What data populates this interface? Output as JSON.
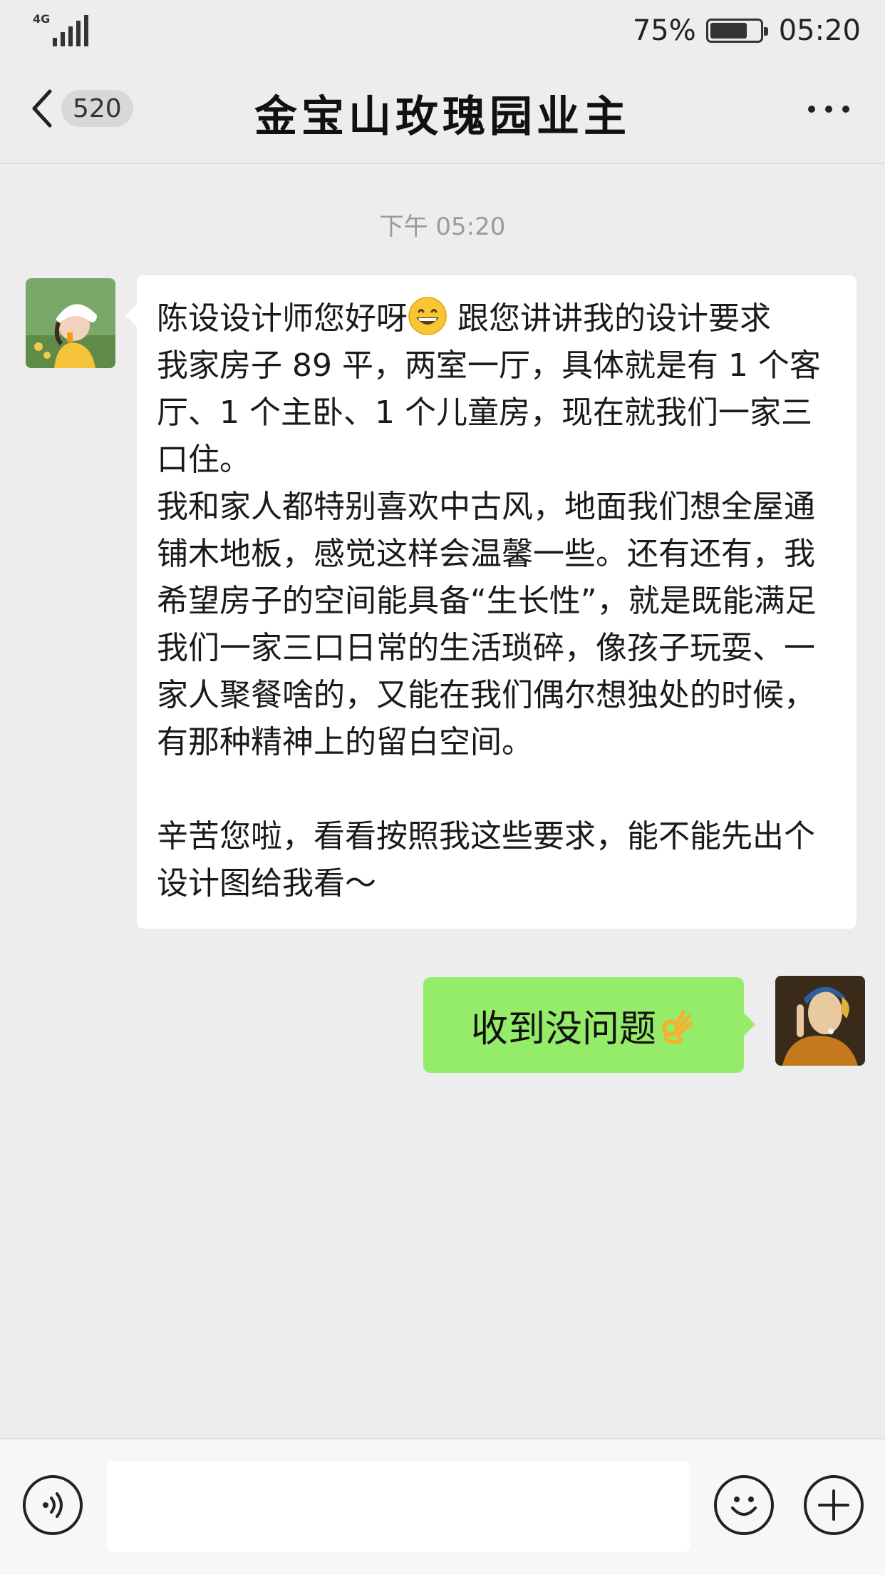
{
  "status_bar": {
    "network": "4G",
    "battery_percent": "75%",
    "battery_level": 0.75,
    "time": "05:20"
  },
  "nav": {
    "unread_badge": "520",
    "title": "金宝山玫瑰园业主"
  },
  "chat": {
    "timestamp": "下午 05:20",
    "incoming": {
      "line_1_before_emoji": "陈设设计师您好呀",
      "line_1_after_emoji": " 跟您讲讲我的设计要求",
      "paragraph_1": "我家房子 89 平，两室一厅，具体就是有 1 个客厅、1 个主卧、1 个儿童房，现在就我们一家三口住。",
      "paragraph_2": "我和家人都特别喜欢中古风，地面我们想全屋通铺木地板，感觉这样会温馨一些。还有还有，我希望房子的空间能具备“生长性”，就是既能满足我们一家三口日常的生活琐碎，像孩子玩耍、一家人聚餐啥的，又能在我们偶尔想独处的时候，有那种精神上的留白空间。",
      "paragraph_3": "辛苦您啦，看看按照我这些要求，能不能先出个设计图给我看～"
    },
    "outgoing": {
      "text": "收到没问题"
    }
  },
  "input_bar": {
    "placeholder": ""
  },
  "colors": {
    "outgoing_bubble": "#95ec69",
    "background": "#ededed"
  }
}
